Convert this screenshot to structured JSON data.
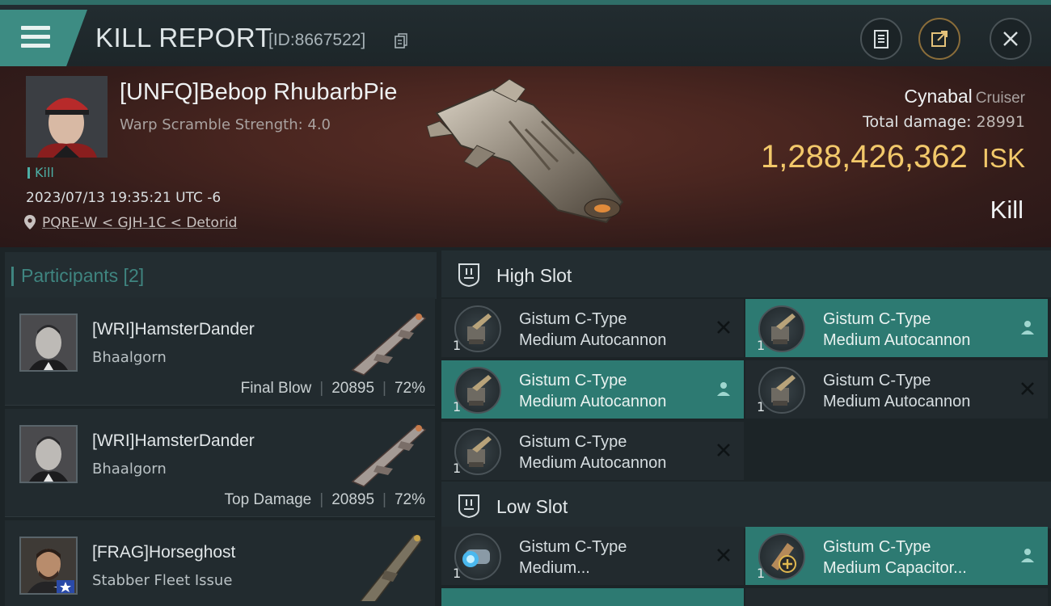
{
  "header": {
    "title": "KILL REPORT",
    "report_id": "[ID:8667522]"
  },
  "victim": {
    "name": "[UNFQ]Bebop RhubarbPie",
    "warp_scramble": "Warp Scramble Strength: 4.0",
    "tag": "Kill",
    "datetime": "2023/07/13 19:35:21 UTC -6",
    "location": "PQRE-W < GJH-1C < Detorid",
    "ship_name": "Cynabal",
    "ship_class": "Cruiser",
    "total_damage_label": "Total damage:",
    "total_damage": "28991",
    "isk_value": "1,288,426,362",
    "isk_unit": "ISK",
    "result": "Kill"
  },
  "participants": {
    "label": "Participants [2]",
    "cards": [
      {
        "name": "[WRI]HamsterDander",
        "ship": "Bhaalgorn",
        "role": "Final Blow",
        "damage": "20895",
        "percent": "72%"
      },
      {
        "name": "[WRI]HamsterDander",
        "ship": "Bhaalgorn",
        "role": "Top Damage",
        "damage": "20895",
        "percent": "72%"
      },
      {
        "name": "[FRAG]Horseghost",
        "ship": "Stabber Fleet Issue",
        "role": "",
        "damage": "",
        "percent": ""
      }
    ]
  },
  "fitting": {
    "high_slot_label": "High Slot",
    "low_slot_label": "Low Slot",
    "high_modules": [
      {
        "line1": "Gistum C-Type",
        "line2": "Medium Autocannon",
        "qty": "1",
        "status": "destroyed"
      },
      {
        "line1": "Gistum C-Type",
        "line2": "Medium Autocannon",
        "qty": "1",
        "status": "dropped"
      },
      {
        "line1": "Gistum C-Type",
        "line2": "Medium Autocannon",
        "qty": "1",
        "status": "dropped"
      },
      {
        "line1": "Gistum C-Type",
        "line2": "Medium Autocannon",
        "qty": "1",
        "status": "destroyed"
      },
      {
        "line1": "Gistum C-Type",
        "line2": "Medium Autocannon",
        "qty": "1",
        "status": "destroyed"
      }
    ],
    "low_modules": [
      {
        "line1": "Gistum C-Type",
        "line2": "Medium...",
        "qty": "1",
        "status": "destroyed"
      },
      {
        "line1": "Gistum C-Type",
        "line2": "Medium Capacitor...",
        "qty": "1",
        "status": "dropped"
      }
    ]
  },
  "colors": {
    "accent": "#3d8c83",
    "isk": "#f2c86a",
    "highlight_module": "#2d7a72"
  }
}
